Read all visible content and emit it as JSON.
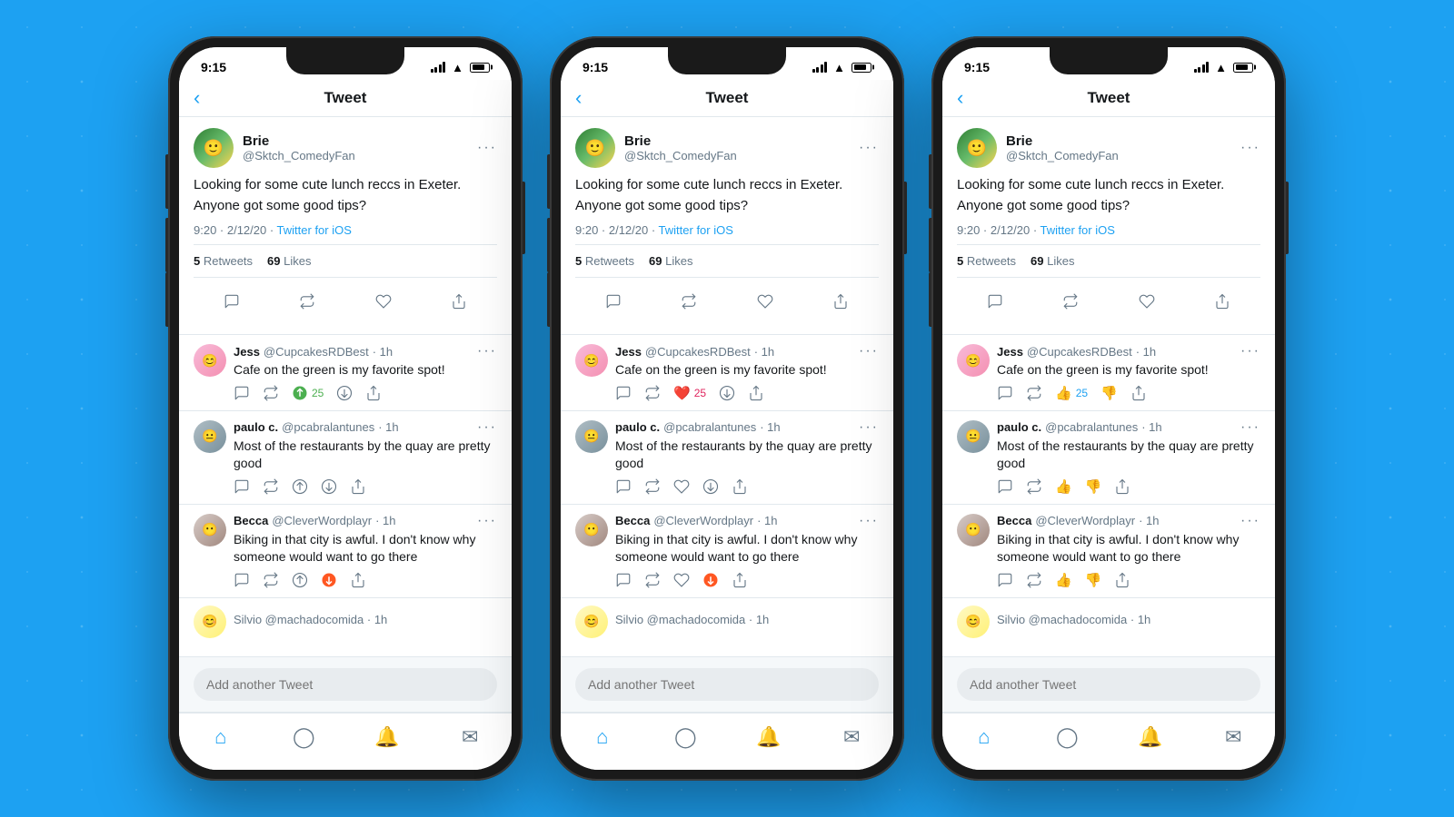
{
  "background_color": "#1da1f2",
  "phones": [
    {
      "id": "phone-1",
      "variant": 1,
      "status": {
        "time": "9:15",
        "battery_percent": 80
      },
      "header": {
        "title": "Tweet",
        "back_label": "‹"
      },
      "main_tweet": {
        "user_name": "Brie",
        "user_handle": "@Sktch_ComedyFan",
        "text": "Looking for some cute lunch reccs in Exeter. Anyone got some good tips?",
        "time": "9:20",
        "date": "2/12/20",
        "source": "Twitter for iOS",
        "retweets": "5",
        "retweets_label": "Retweets",
        "likes": "69",
        "likes_label": "Likes"
      },
      "replies": [
        {
          "name": "Jess",
          "handle": "@CupcakesRDBest",
          "time": "1h",
          "text": "Cafe on the green is my favorite spot!",
          "votes": "25",
          "vote_type": "up"
        },
        {
          "name": "paulo c.",
          "handle": "@pcabralantunes",
          "time": "1h",
          "text": "Most of the restaurants by the quay are pretty good",
          "votes": "",
          "vote_type": "neutral"
        },
        {
          "name": "Becca",
          "handle": "@CleverWordplayr",
          "time": "1h",
          "text": "Biking in that city is awful. I don't know why someone would want to go there",
          "votes": "",
          "vote_type": "down"
        }
      ],
      "add_tweet_placeholder": "Add another Tweet",
      "tabs": [
        "home",
        "search",
        "notifications",
        "mail"
      ]
    }
  ],
  "action_icons": {
    "comment": "💬",
    "retweet": "🔁",
    "like": "🤍",
    "share": "⬆"
  }
}
